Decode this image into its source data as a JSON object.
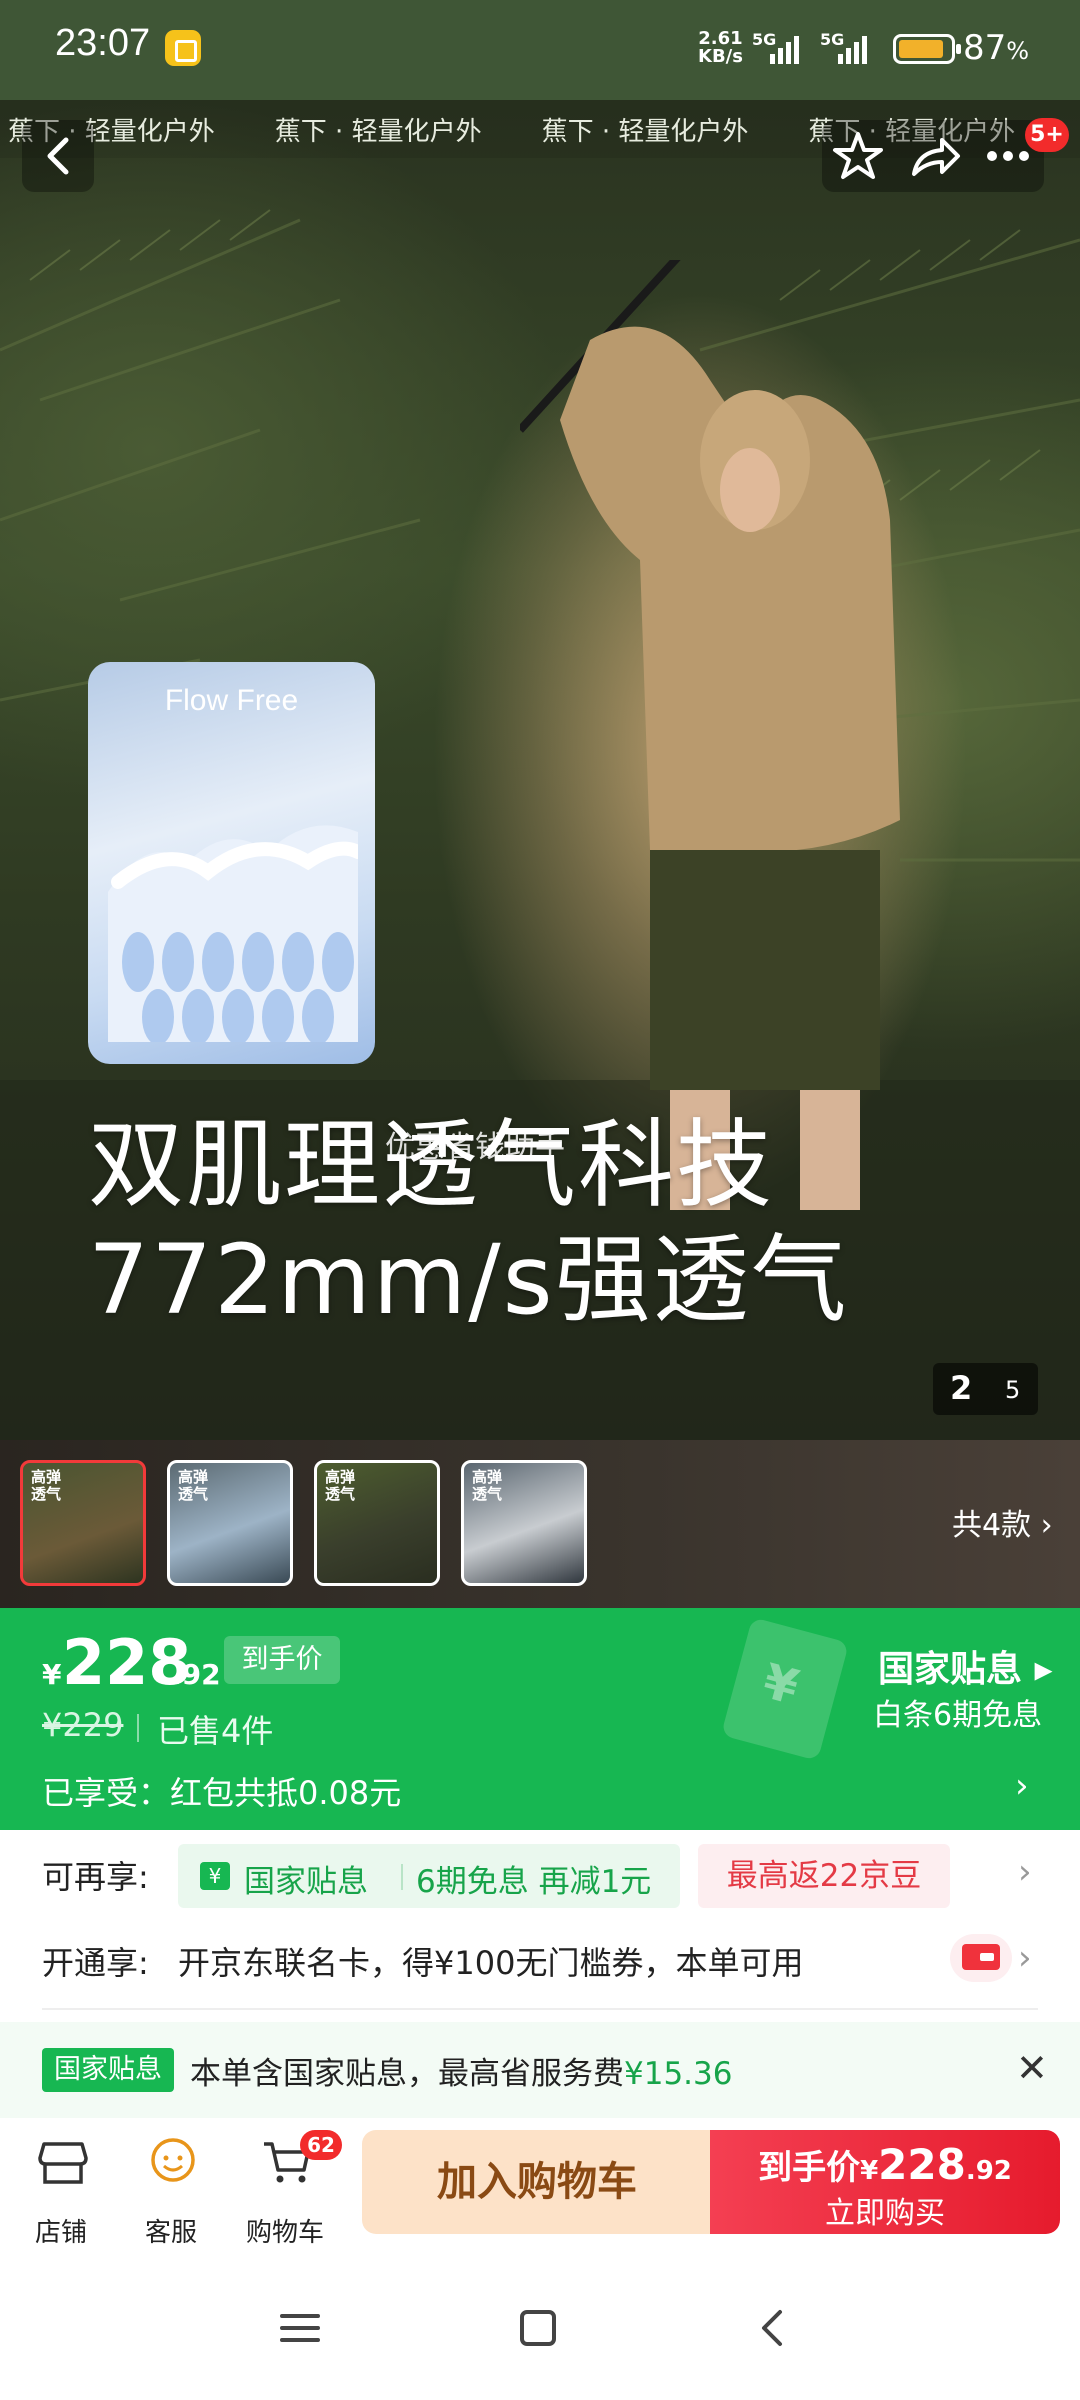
{
  "status_bar": {
    "time": "23:07",
    "net_speed_value": "2.61",
    "net_speed_unit": "KB/s",
    "sim1": "5G",
    "sim2": "5G",
    "battery_pct": "87",
    "battery_suffix": "%",
    "battery_level": 0.87
  },
  "hero": {
    "brand_strip": [
      "蕉下 · 轻量化户外",
      "蕉下 · 轻量化户外",
      "蕉下 · 轻量化户外",
      "蕉下 · 轻量化户外"
    ],
    "flow_card_title": "Flow Free",
    "headline_line1": "双肌理透气科技",
    "headline_line2": "772mm/s强透气",
    "watermark": "优惠省钱助手",
    "pager_current": "2",
    "pager_total": "5",
    "top_badge": "5+"
  },
  "thumbnails": {
    "items": [
      {
        "label": "高弹\n透气",
        "selected": true
      },
      {
        "label": "高弹\n透气",
        "selected": false
      },
      {
        "label": "高弹\n透气",
        "selected": false
      },
      {
        "label": "高弹\n透气",
        "selected": false
      }
    ],
    "count_label": "共4款"
  },
  "price": {
    "currency": "¥",
    "integer": "228",
    "decimal": ".92",
    "final_tag": "到手价",
    "original": "¥229",
    "sold": "已售4件",
    "enjoyed": "已享受：红包共抵0.08元",
    "subsidy_title": "国家贴息",
    "subsidy_sub": "白条6期免息"
  },
  "perks": {
    "label": "可再享:",
    "subsidy": "国家贴息",
    "installment": "6期免息 再减1元",
    "jd_beans": "最高返22京豆",
    "open_label": "开通享:",
    "open_text": "开京东联名卡，得¥100无门槛券，本单可用"
  },
  "subsidy_bar": {
    "tag": "国家贴息",
    "text": "本单含国家贴息，最高省服务费",
    "amount": "¥15.36"
  },
  "action_bar": {
    "shop": "店铺",
    "service": "客服",
    "cart": "购物车",
    "cart_count": "62",
    "add_to_cart": "加入购物车",
    "buy_price_prefix": "到手价",
    "buy_currency": "¥",
    "buy_int": "228",
    "buy_dec": ".92",
    "buy_now": "立即购买"
  },
  "icons": [
    "back-icon",
    "star-icon",
    "share-icon",
    "more-icon",
    "shop-icon",
    "service-icon",
    "cart-icon",
    "close-icon",
    "menu-nav-icon",
    "home-nav-icon",
    "back-nav-icon"
  ],
  "colors": {
    "status_bg": "#3f5636",
    "price_green": "#17b752",
    "buy_red": "#e61b2d",
    "cart_orange": "#fde2c8"
  }
}
